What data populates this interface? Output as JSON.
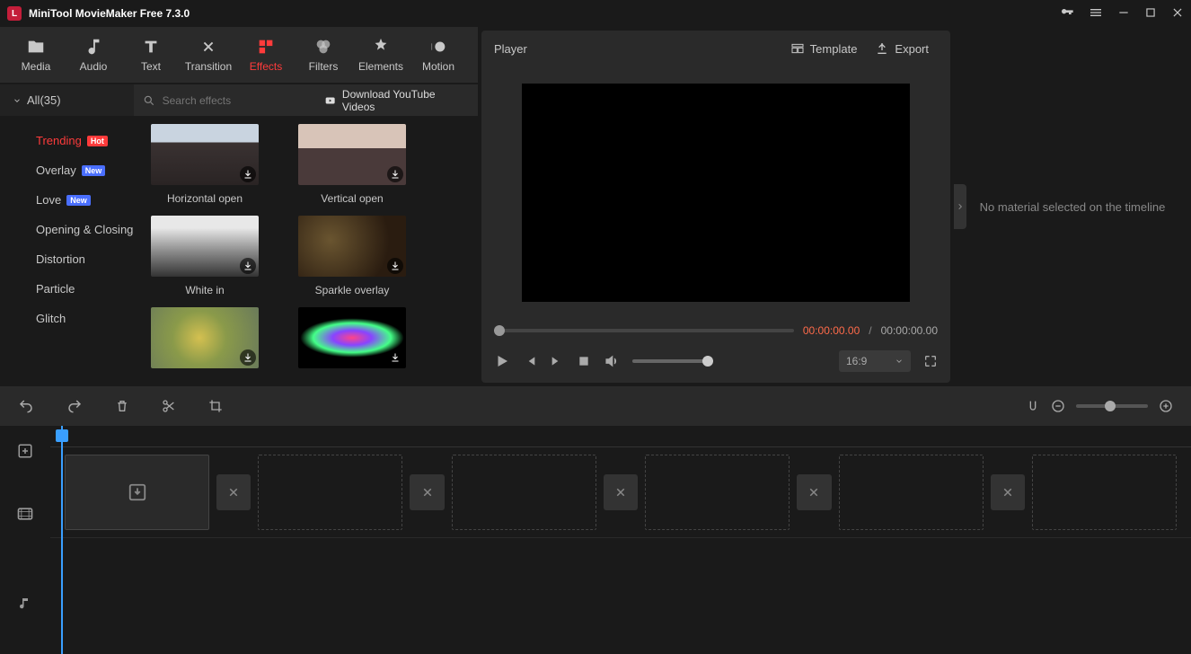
{
  "titlebar": {
    "title": "MiniTool MovieMaker Free 7.3.0"
  },
  "toolbar": {
    "media": "Media",
    "audio": "Audio",
    "text": "Text",
    "transition": "Transition",
    "effects": "Effects",
    "filters": "Filters",
    "elements": "Elements",
    "motion": "Motion"
  },
  "sidebar": {
    "all_label": "All(35)",
    "search_placeholder": "Search effects",
    "youtube_label": "Download YouTube Videos",
    "categories": [
      {
        "label": "Trending",
        "badge": "Hot"
      },
      {
        "label": "Overlay",
        "badge": "New"
      },
      {
        "label": "Love",
        "badge": "New"
      },
      {
        "label": "Opening & Closing"
      },
      {
        "label": "Distortion"
      },
      {
        "label": "Particle"
      },
      {
        "label": "Glitch"
      }
    ]
  },
  "effects": [
    {
      "name": "Horizontal open"
    },
    {
      "name": "Vertical open"
    },
    {
      "name": "White in"
    },
    {
      "name": "Sparkle overlay"
    },
    {
      "name": ""
    },
    {
      "name": ""
    }
  ],
  "player": {
    "title": "Player",
    "template": "Template",
    "export": "Export",
    "cur_time": "00:00:00.00",
    "sep": "/",
    "total_time": "00:00:00.00",
    "aspect": "16:9"
  },
  "props": {
    "empty_msg": "No material selected on the timeline"
  }
}
